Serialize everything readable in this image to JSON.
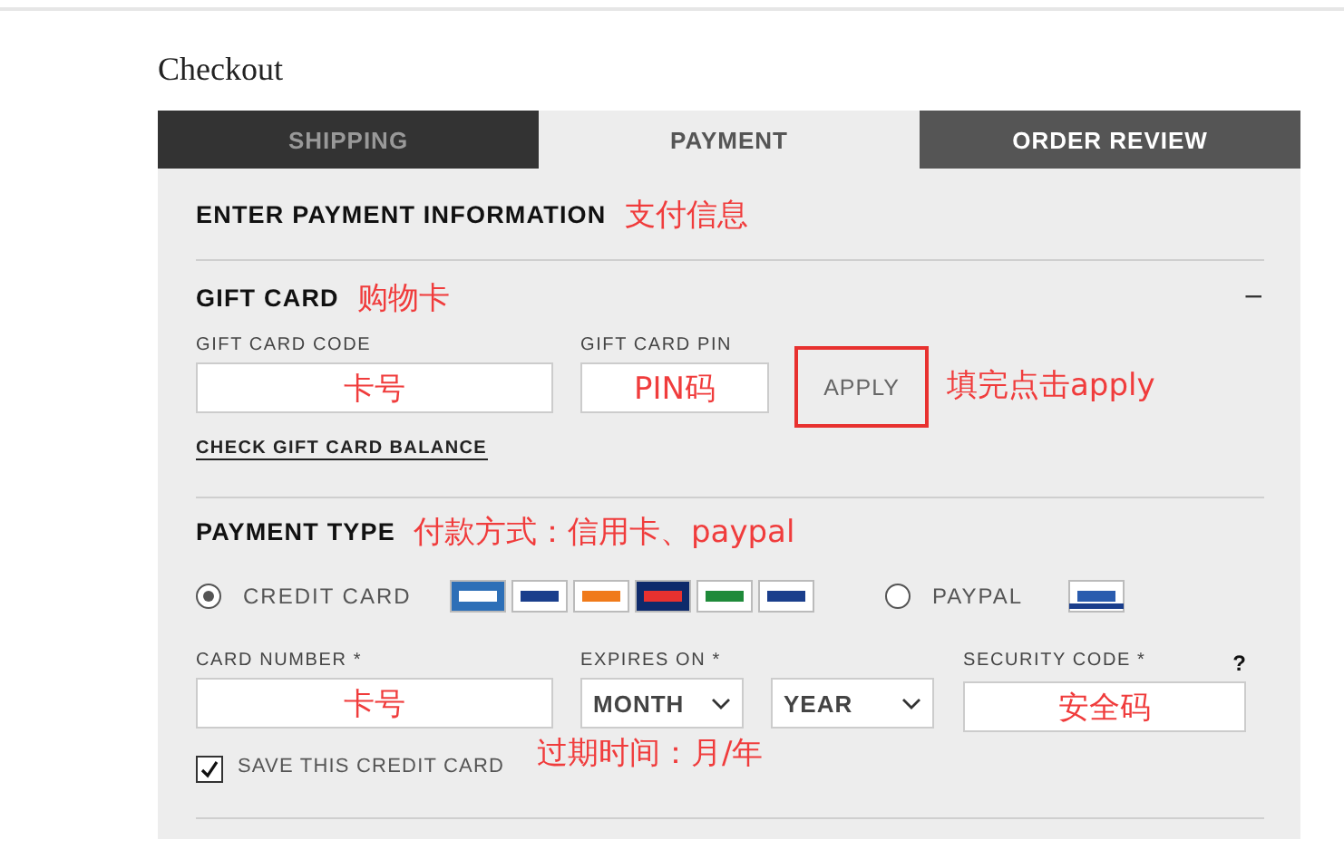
{
  "page_title": "Checkout",
  "tabs": [
    {
      "label": "SHIPPING",
      "selected": false,
      "kind": "done"
    },
    {
      "label": "PAYMENT",
      "selected": true,
      "kind": "current"
    },
    {
      "label": "ORDER REVIEW",
      "selected": false,
      "kind": "upcoming"
    }
  ],
  "header": {
    "title": "ENTER PAYMENT INFORMATION",
    "note": "支付信息"
  },
  "gift_card": {
    "title": "GIFT CARD",
    "note": "购物卡",
    "toggle": "−",
    "expanded": true,
    "fields": [
      {
        "label": "GIFT CARD CODE",
        "note": "卡号"
      },
      {
        "label": "GIFT CARD PIN",
        "note": "PIN码"
      }
    ],
    "apply": {
      "label": "APPLY",
      "highlighted": true
    },
    "apply_note": "填完点击apply",
    "balance_link": "CHECK GIFT CARD BALANCE"
  },
  "payment_type": {
    "title": "PAYMENT TYPE",
    "note": "付款方式：信用卡、paypal",
    "options": [
      {
        "label": "CREDIT CARD",
        "selected": true,
        "kind": "cards"
      },
      {
        "label": "PAYPAL",
        "selected": false,
        "kind": "paypal"
      }
    ],
    "card_number": {
      "label": "CARD NUMBER",
      "required": "*",
      "note": "卡号"
    },
    "expires": {
      "label": "EXPIRES ON",
      "required": "*",
      "month": "MONTH",
      "year": "YEAR",
      "note": "过期时间：月/年"
    },
    "security": {
      "label": "SECURITY CODE",
      "required": "*",
      "help": "?",
      "note": "安全码"
    },
    "save_card": {
      "label": "SAVE THIS CREDIT CARD",
      "checked": true
    }
  }
}
